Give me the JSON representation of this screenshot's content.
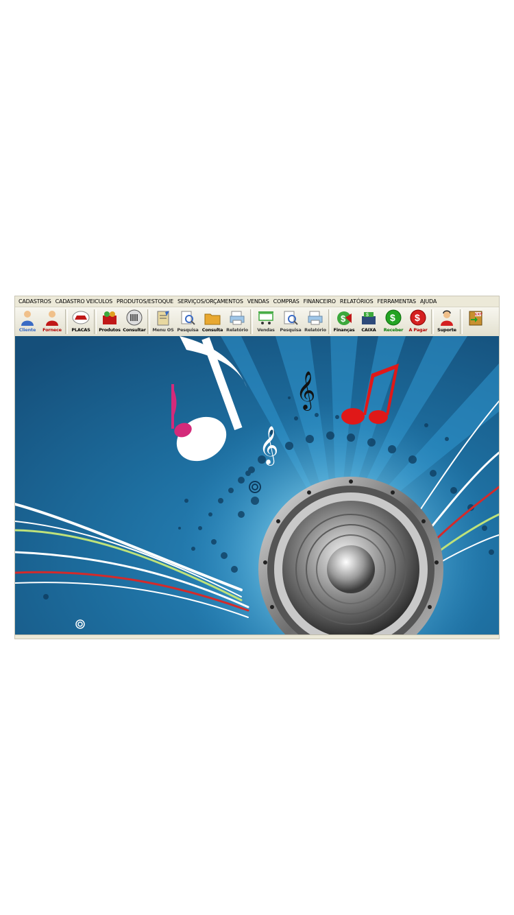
{
  "menu": [
    "CADASTROS",
    "CADASTRO VEICULOS",
    "PRODUTOS/ESTOQUE",
    "SERVIÇOS/ORÇAMENTOS",
    "VENDAS",
    "COMPRAS",
    "FINANCEIRO",
    "RELATÓRIOS",
    "FERRAMENTAS",
    "AJUDA"
  ],
  "toolbar": [
    {
      "label": "Cliente",
      "icon": "person-icon",
      "color": "#3a6bc4"
    },
    {
      "label": "Fornece",
      "icon": "supplier-icon",
      "color": "#b00000"
    },
    {
      "sep": true
    },
    {
      "label": "PLACAS",
      "icon": "car-icon",
      "color": "#000000"
    },
    {
      "sep": true
    },
    {
      "label": "Produtos",
      "icon": "products-box-icon",
      "color": "#000000"
    },
    {
      "label": "Consultar",
      "icon": "barcode-icon",
      "color": "#000000"
    },
    {
      "sep": true
    },
    {
      "label": "Menu OS",
      "icon": "clipboard-icon",
      "color": "#3a3a3a"
    },
    {
      "label": "Pesquisa",
      "icon": "magnifier-doc-icon",
      "color": "#3a3a3a"
    },
    {
      "label": "Consulta",
      "icon": "folder-icon",
      "color": "#000000"
    },
    {
      "label": "Relatório",
      "icon": "printer-icon",
      "color": "#3a3a3a"
    },
    {
      "sep": true
    },
    {
      "label": "Vendas",
      "icon": "cart-icon",
      "color": "#3a3a3a"
    },
    {
      "label": "Pesquisa",
      "icon": "magnifier-doc-icon",
      "color": "#3a3a3a"
    },
    {
      "label": "Relatório",
      "icon": "printer-icon",
      "color": "#3a3a3a"
    },
    {
      "sep": true
    },
    {
      "label": "Finanças",
      "icon": "finance-icon",
      "color": "#000000"
    },
    {
      "label": "CAIXA",
      "icon": "cash-register-icon",
      "color": "#000000"
    },
    {
      "label": "Receber",
      "icon": "dollar-green-icon",
      "color": "#0a7a0a"
    },
    {
      "label": "A Pagar",
      "icon": "dollar-red-icon",
      "color": "#b00000"
    },
    {
      "sep": true
    },
    {
      "label": "Suporte",
      "icon": "support-icon",
      "color": "#000000"
    },
    {
      "sep": true
    },
    {
      "label": "",
      "icon": "exit-icon",
      "color": "#000000"
    }
  ]
}
